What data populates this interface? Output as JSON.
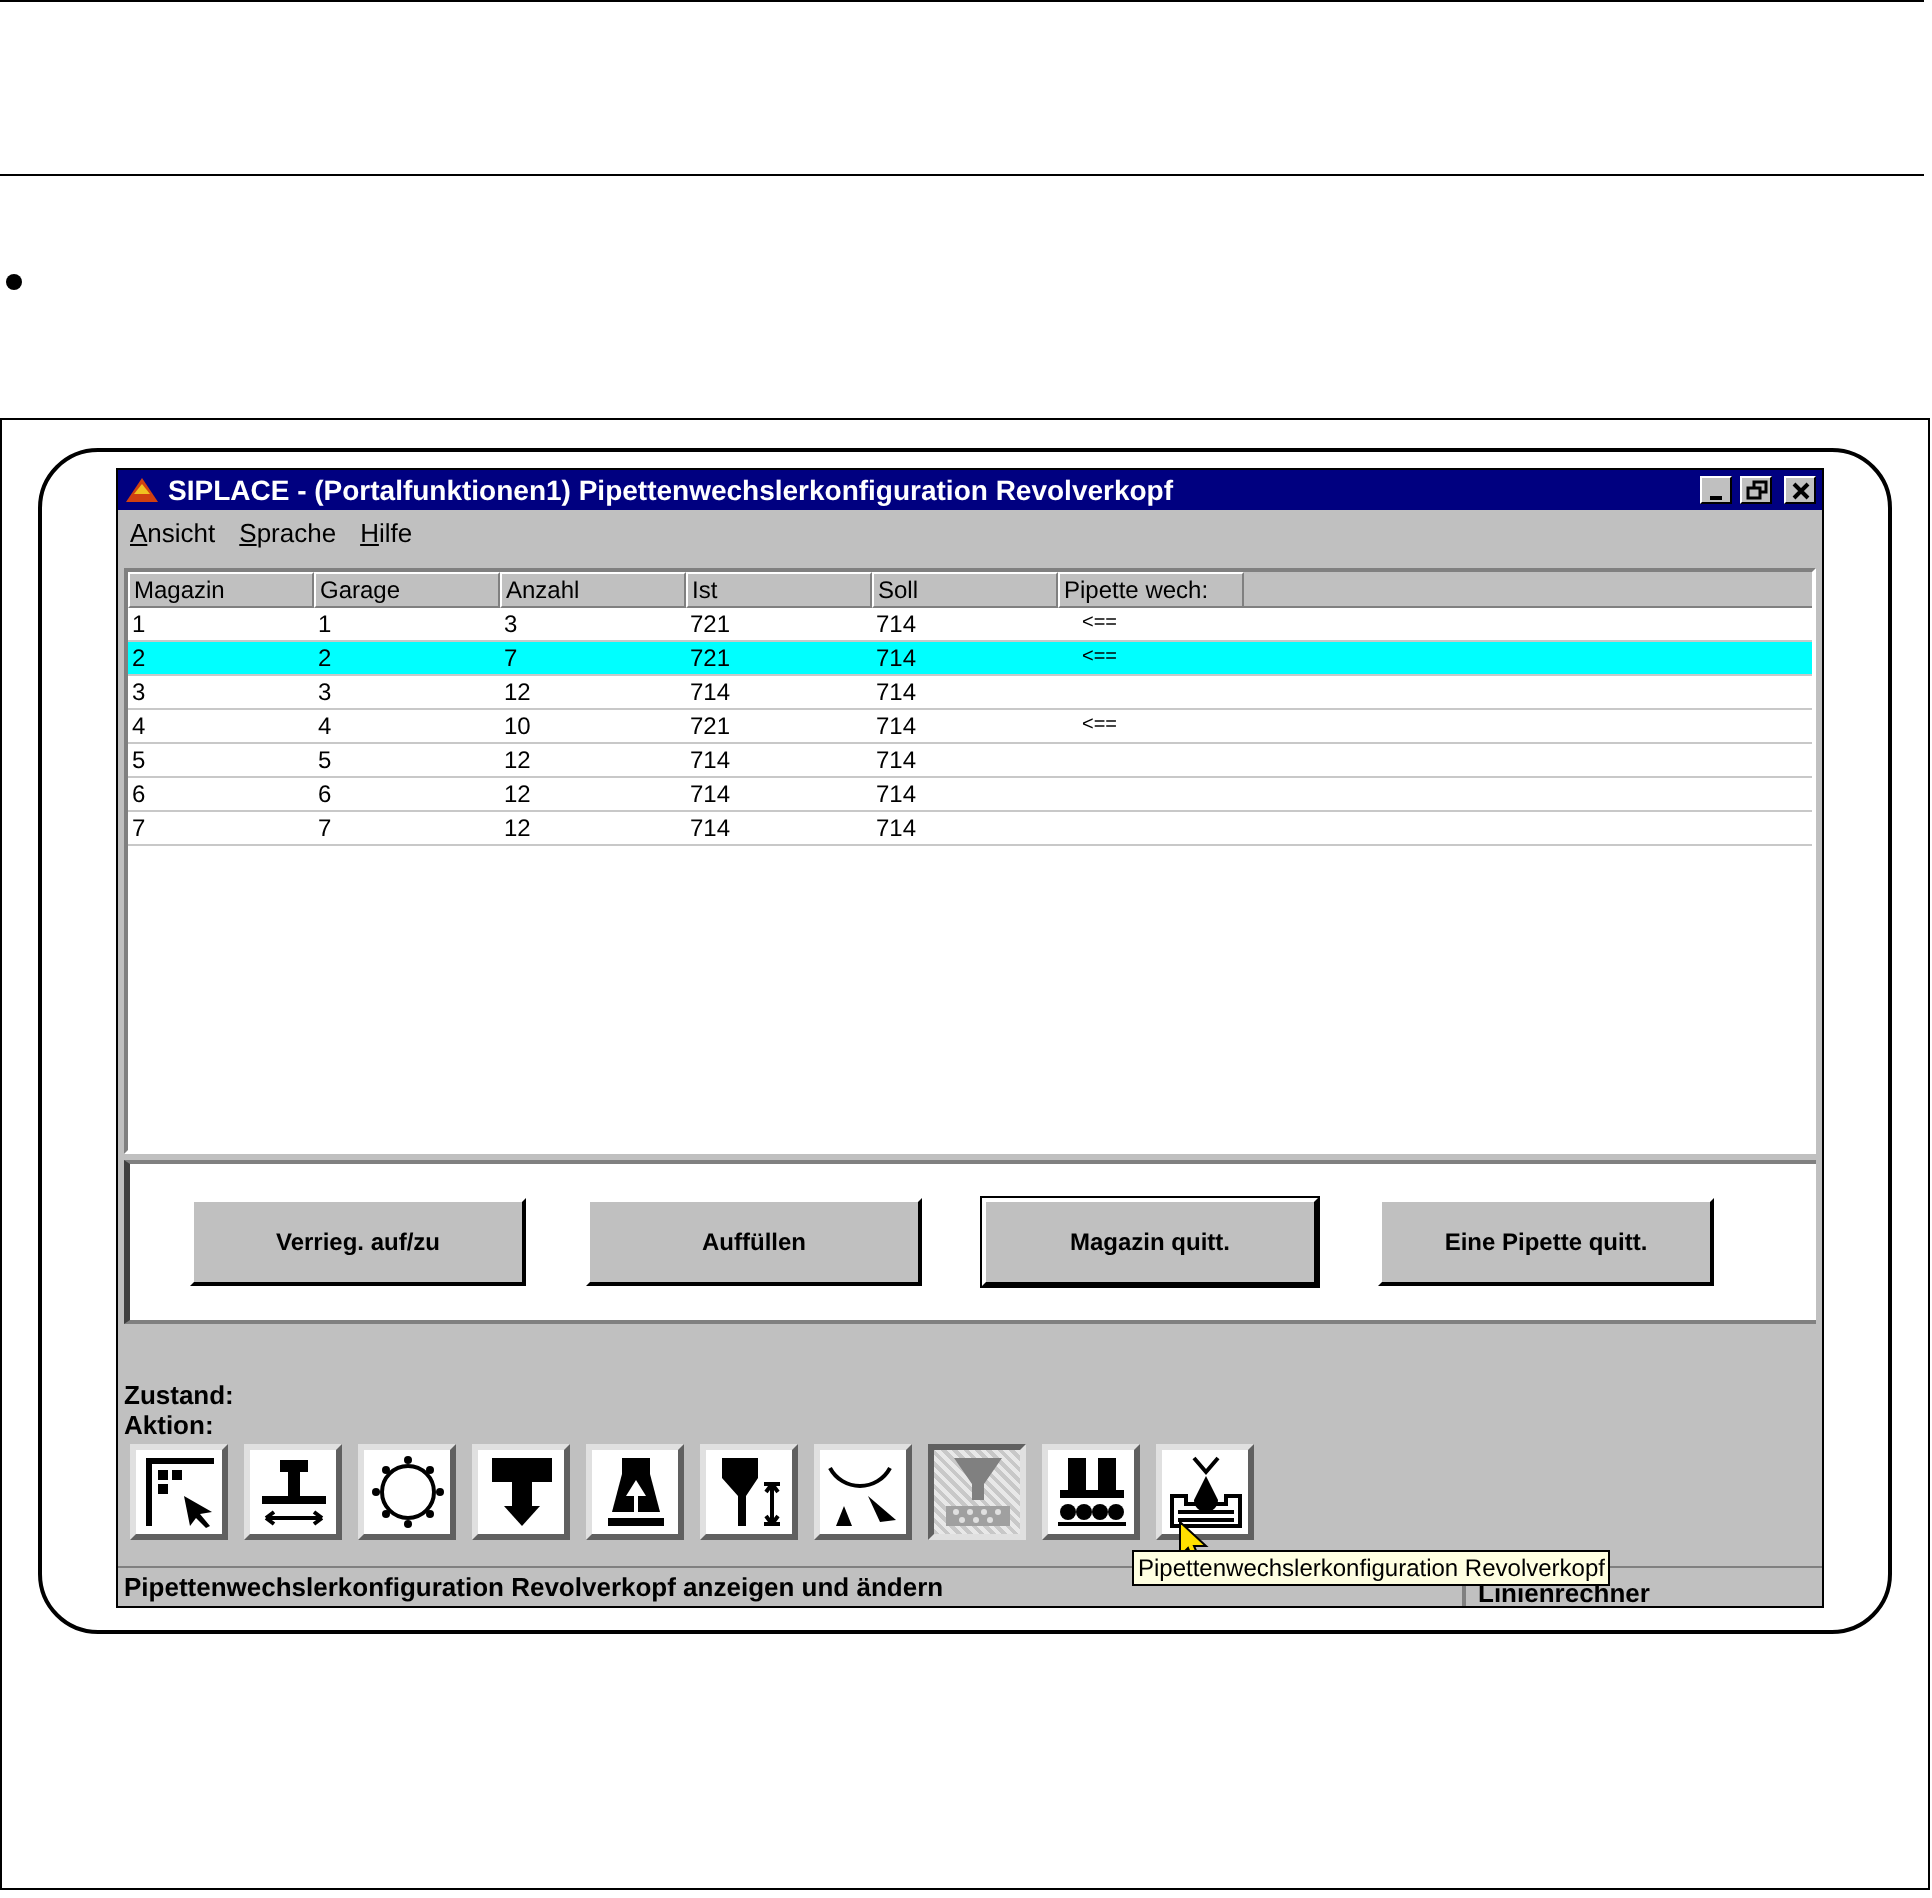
{
  "window": {
    "title": "SIPLACE - (Portalfunktionen1) Pipettenwechslerkonfiguration Revolverkopf"
  },
  "menu": [
    {
      "label": "Ansicht"
    },
    {
      "label": "Sprache"
    },
    {
      "label": "Hilfe"
    }
  ],
  "table": {
    "columns": [
      "Magazin",
      "Garage",
      "Anzahl",
      "Ist",
      "Soll",
      "Pipette wech:"
    ],
    "rows": [
      {
        "cells": [
          "1",
          "1",
          "3",
          "721",
          "714",
          "<=="
        ],
        "selected": false
      },
      {
        "cells": [
          "2",
          "2",
          "7",
          "721",
          "714",
          "<=="
        ],
        "selected": true
      },
      {
        "cells": [
          "3",
          "3",
          "12",
          "714",
          "714",
          ""
        ],
        "selected": false
      },
      {
        "cells": [
          "4",
          "4",
          "10",
          "721",
          "714",
          "<=="
        ],
        "selected": false
      },
      {
        "cells": [
          "5",
          "5",
          "12",
          "714",
          "714",
          ""
        ],
        "selected": false
      },
      {
        "cells": [
          "6",
          "6",
          "12",
          "714",
          "714",
          ""
        ],
        "selected": false
      },
      {
        "cells": [
          "7",
          "7",
          "12",
          "714",
          "714",
          ""
        ],
        "selected": false
      }
    ]
  },
  "buttons": [
    {
      "label": "Verrieg. auf/zu",
      "default": false
    },
    {
      "label": "Auffüllen",
      "default": false
    },
    {
      "label": "Magazin quitt.",
      "default": true
    },
    {
      "label": "Eine Pipette quitt.",
      "default": false
    }
  ],
  "status_labels": [
    "Zustand:",
    "Aktion:"
  ],
  "toolbar": [
    {
      "selected": false
    },
    {
      "selected": false
    },
    {
      "selected": false
    },
    {
      "selected": false
    },
    {
      "selected": false
    },
    {
      "selected": false
    },
    {
      "selected": false
    },
    {
      "selected": true
    },
    {
      "selected": false
    },
    {
      "selected": false
    }
  ],
  "tooltip": "Pipettenwechslerkonfiguration Revolverkopf",
  "status_bar": {
    "message": "Pipettenwechslerkonfiguration Revolverkopf anzeigen und ändern",
    "right": "Linienrechner"
  }
}
